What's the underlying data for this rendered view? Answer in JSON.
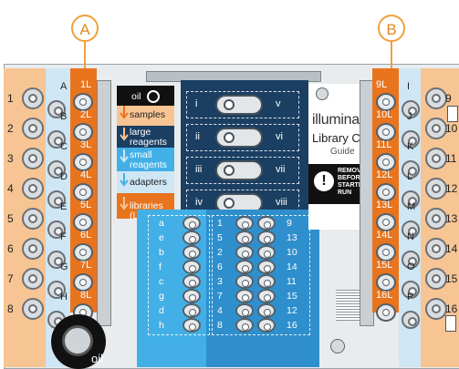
{
  "callouts": {
    "a": "A",
    "b": "B"
  },
  "left_strip": {
    "letters": [
      "A",
      "B",
      "C",
      "D",
      "E",
      "F",
      "G",
      "H"
    ],
    "numbers": [
      "1",
      "2",
      "3",
      "4",
      "5",
      "6",
      "7",
      "8"
    ],
    "orange_labels": [
      "1L",
      "2L",
      "3L",
      "4L",
      "5L",
      "6L",
      "7L",
      "8L"
    ],
    "oil_label": "oil"
  },
  "right_strip": {
    "orange_labels": [
      "9L",
      "10L",
      "11L",
      "12L",
      "13L",
      "14L",
      "15L",
      "16L"
    ],
    "letters": [
      "I",
      "J",
      "K",
      "L",
      "M",
      "N",
      "O",
      "P"
    ],
    "numbers": [
      "9",
      "10",
      "11",
      "12",
      "13",
      "14",
      "15",
      "16"
    ]
  },
  "legend": {
    "oil": "oil",
    "samples": "samples",
    "large_reagents": "large reagents",
    "small_reagents": "small reagents",
    "adapters": "adapters",
    "libraries": "libraries (L)"
  },
  "reagents_roman_left": [
    "i",
    "ii",
    "iii",
    "iv"
  ],
  "reagents_roman_right": [
    "v",
    "vi",
    "vii",
    "viii"
  ],
  "small_reagents": {
    "col1": [
      "a",
      "e",
      "b",
      "f",
      "c",
      "g",
      "d",
      "h"
    ],
    "col2": [
      "1",
      "5",
      "2",
      "6",
      "3",
      "7",
      "4",
      "8"
    ],
    "col3": [
      "9",
      "13",
      "10",
      "14",
      "11",
      "15",
      "12",
      "16"
    ]
  },
  "card": {
    "brand": "illumina",
    "title": "Library Card",
    "subtitle": "Guide",
    "warning": "REMOVE BEFORE STARTING RUN"
  },
  "colors": {
    "orange": "#e8741e",
    "peach": "#f7c493",
    "light_blue": "#cfe6f5",
    "cyan": "#42b0e6",
    "navy": "#1b3f62",
    "black": "#111111"
  }
}
